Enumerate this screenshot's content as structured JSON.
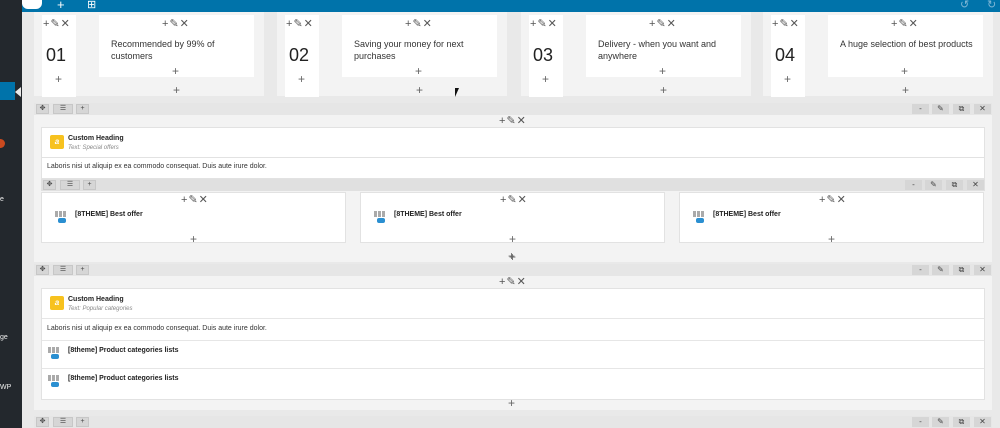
{
  "sidebar": {
    "labels": [
      "e",
      "ge",
      "WP"
    ]
  },
  "features": [
    {
      "number": "01",
      "text": "Recommended by 99% of customers"
    },
    {
      "number": "02",
      "text": "Saving your money for next purchases"
    },
    {
      "number": "03",
      "text": "Delivery - when you want and anywhere"
    },
    {
      "number": "04",
      "text": "A huge selection of best products"
    }
  ],
  "controls": {
    "add": "+",
    "edit": "✎",
    "remove": "✕",
    "minus": "-",
    "move": "✥",
    "columns": "☰",
    "copy": "⧉"
  },
  "section1": {
    "heading_title": "Custom Heading",
    "heading_sub": "Text: Special offers",
    "body": "Laboris nisi ut aliquip ex ea commodo consequat. Duis aute irure dolor.",
    "offers": [
      "[8THEME] Best offer",
      "[8THEME] Best offer",
      "[8THEME] Best offer"
    ]
  },
  "section2": {
    "heading_title": "Custom Heading",
    "heading_sub": "Text: Popular categories",
    "body": "Laboris nisi ut aliquip ex ea commodo consequat. Duis aute irure dolor.",
    "lists": [
      "[8theme] Product categories lists",
      "[8theme] Product categories lists"
    ]
  }
}
